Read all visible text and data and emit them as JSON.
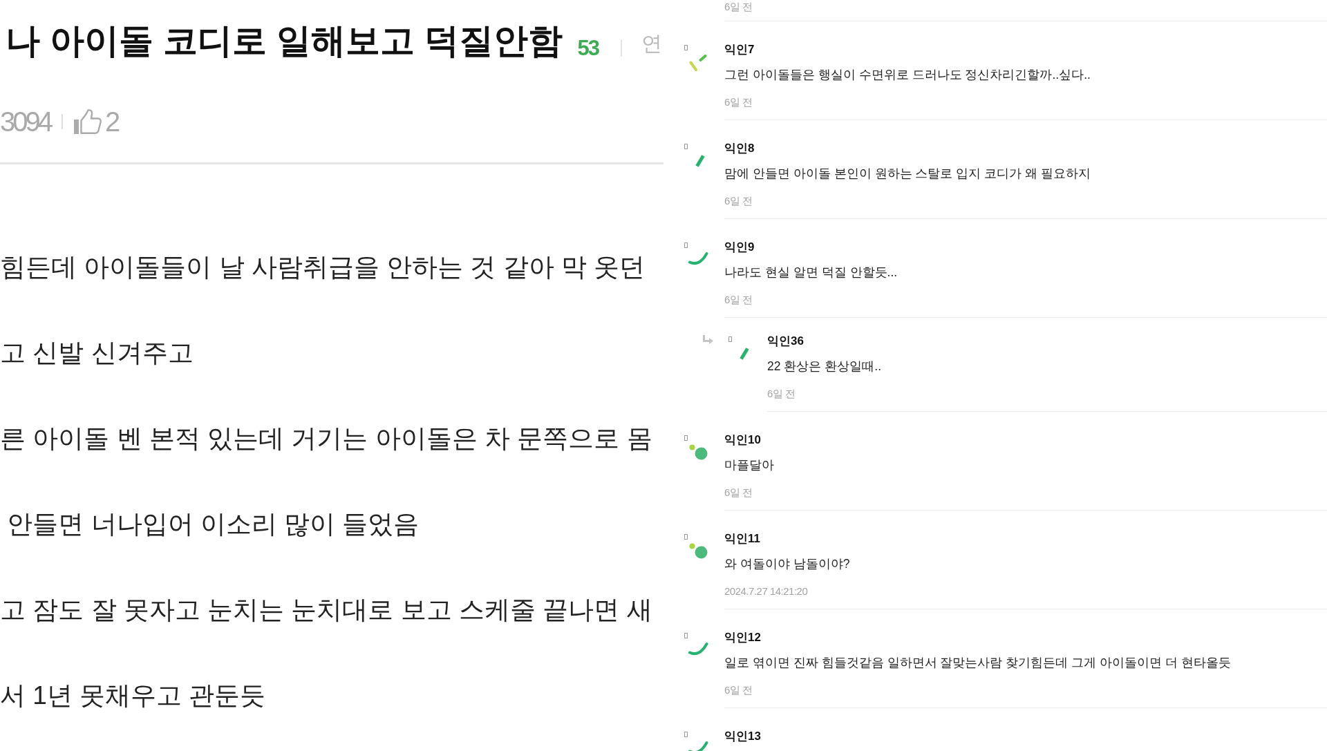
{
  "post": {
    "title": "나 아이돌 코디로 일해보고 덕질안함",
    "comment_count": "53",
    "category": "연",
    "views": "3094",
    "likes": "2",
    "body_lines": [
      "힘든데 아이돌들이 날 사람취급을 안하는 것 같아 막 옷던",
      "고 신발 신겨주고",
      "른 아이돌 벤 본적 있는데 거기는 아이돌은 차 문쪽으로 몸",
      " 안들면 너나입어 이소리 많이 들었음",
      "고 잠도 잘 못자고 눈치는 눈치대로 보고 스케줄 끝나면 새",
      "서 1년 못채우고 관둔듯"
    ]
  },
  "comments": [
    {
      "time": "6일 전"
    },
    {
      "name": "익인7",
      "kind": "dashes",
      "text": "그런 아이돌들은 행실이 수면위로 드러나도 정신차리긴할까..싶다..",
      "time": "6일 전"
    },
    {
      "name": "익인8",
      "kind": "bar",
      "text": "맘에 안들면 아이돌 본인이 원하는 스탈로 입지 코디가 왜 필요하지",
      "time": "6일 전"
    },
    {
      "name": "익인9",
      "kind": "arc",
      "text": "나라도 현실 알면 덕질 안할듯...",
      "time": "6일 전",
      "replies": [
        {
          "name": "익인36",
          "kind": "bar",
          "text": "22 환상은 환상일때..",
          "time": "6일 전"
        }
      ]
    },
    {
      "name": "익인10",
      "kind": "dots",
      "text": "마플달아",
      "time": "6일 전"
    },
    {
      "name": "익인11",
      "kind": "dots",
      "text": "와 여돌이야 남돌이야?",
      "time": "2024.7.27 14:21:20"
    },
    {
      "name": "익인12",
      "kind": "arc",
      "text": "일로 엮이면 진짜 힘들것같음 일하면서 잘맞는사람 찾기힘든데 그게 아이돌이면 더 현타올듯",
      "time": "6일 전"
    },
    {
      "name": "익인13",
      "kind": "arc"
    }
  ]
}
